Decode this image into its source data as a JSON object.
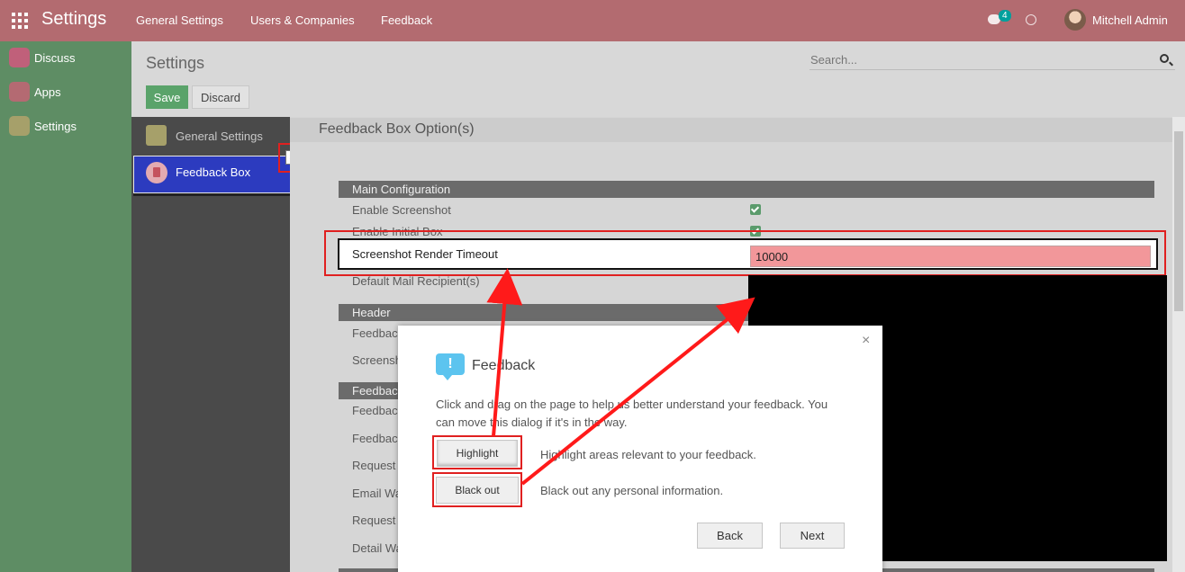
{
  "navbar": {
    "title": "Settings",
    "menu": [
      "General Settings",
      "Users & Companies",
      "Feedback"
    ],
    "chat_count": "4",
    "user_name": "Mitchell Admin"
  },
  "sidebar": {
    "items": [
      {
        "label": "Discuss",
        "color": "#c0607a"
      },
      {
        "label": "Apps",
        "color": "#b46a72"
      },
      {
        "label": "Settings",
        "color": "#a6a06a"
      }
    ]
  },
  "control": {
    "title": "Settings",
    "save_label": "Save",
    "discard_label": "Discard",
    "search_placeholder": "Search..."
  },
  "settings_nav": {
    "general": "General Settings",
    "feedback": "Feedback Box",
    "close": "×"
  },
  "content": {
    "section_title": "Feedback Box Option(s)",
    "groups": {
      "main": "Main Configuration",
      "header": "Header",
      "feedback": "Feedbac"
    },
    "rows": {
      "enable_screenshot": "Enable Screenshot",
      "enable_initial_box": "Enable Initial Box",
      "screenshot_render_timeout": "Screenshot Render Timeout",
      "timeout_value": "10000",
      "default_mail_recipients": "Default Mail Recipient(s)",
      "header_row1": "Feedbac",
      "header_row2": "Screensh",
      "fb_row1": "Feedbac",
      "fb_row2": "Feedbac",
      "fb_row3": "Request",
      "fb_row4": "Email Wa",
      "fb_row5": "Request",
      "fb_row6": "Detail Wa"
    }
  },
  "dialog": {
    "close": "×",
    "icon": "!",
    "title": "Feedback",
    "text": "Click and drag on the page to help us better understand your feedback. You can move this dialog if it's in the way.",
    "highlight_label": "Highlight",
    "highlight_desc": "Highlight areas relevant to your feedback.",
    "blackout_label": "Black out",
    "blackout_desc": "Black out any personal information.",
    "back_label": "Back",
    "next_label": "Next"
  }
}
